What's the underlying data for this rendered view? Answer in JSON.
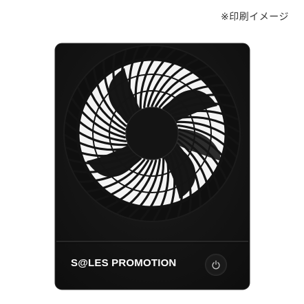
{
  "caption": {
    "note": "※印刷イメージ"
  },
  "product": {
    "imprint_text": "S@LES PROMOTION",
    "body_color": "#141414",
    "accent_color": "#ffffff",
    "icons": [
      "fan-icon",
      "power-icon"
    ]
  }
}
